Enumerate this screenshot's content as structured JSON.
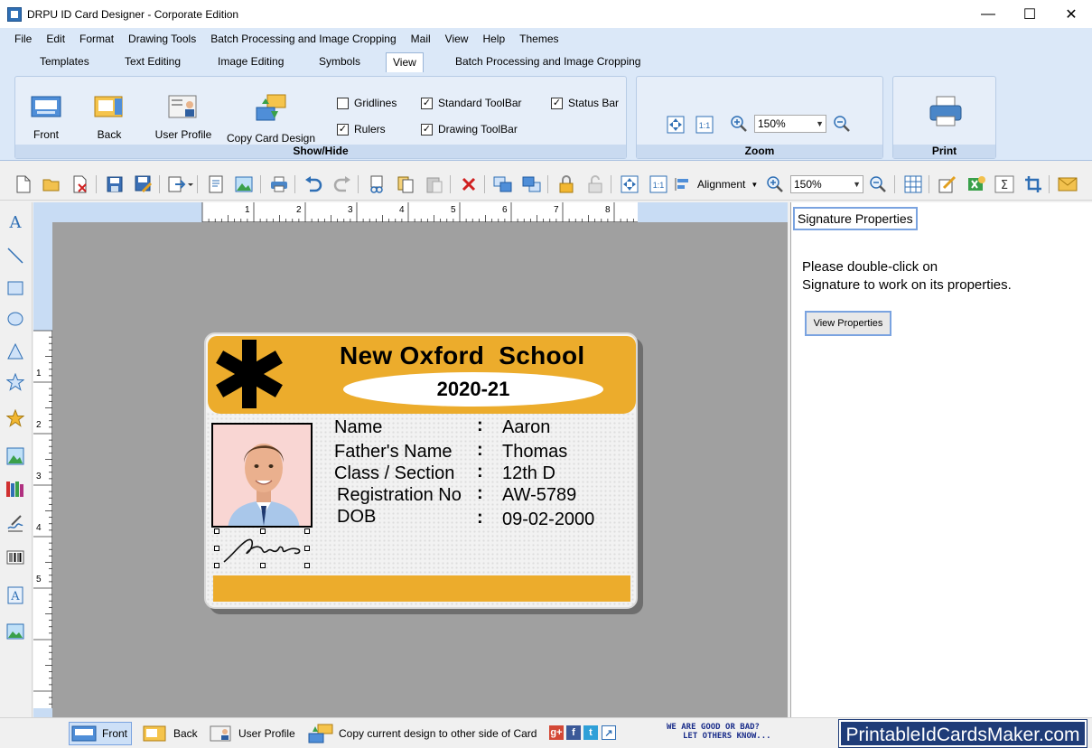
{
  "window": {
    "title": "DRPU ID Card Designer - Corporate Edition",
    "controls": [
      "—",
      "☐",
      "✕"
    ]
  },
  "menu": [
    "File",
    "Edit",
    "Format",
    "Drawing Tools",
    "Batch Processing and Image Cropping",
    "Mail",
    "View",
    "Help",
    "Themes"
  ],
  "ribbon_tabs": [
    "Templates",
    "Text Editing",
    "Image Editing",
    "Symbols",
    "View",
    "Batch Processing and Image Cropping"
  ],
  "ribbon": {
    "show_hide": {
      "label": "Show/Hide",
      "buttons": [
        "Front",
        "Back",
        "User Profile",
        "Copy Card Design"
      ],
      "checks": [
        {
          "label": "Gridlines",
          "checked": false
        },
        {
          "label": "Rulers",
          "checked": true
        },
        {
          "label": "Standard ToolBar",
          "checked": true
        },
        {
          "label": "Drawing ToolBar",
          "checked": true
        },
        {
          "label": "Status Bar",
          "checked": true
        }
      ]
    },
    "zoom": {
      "label": "Zoom",
      "value": "150%"
    },
    "print": {
      "label": "Print"
    }
  },
  "toolbar": {
    "alignment_label": "Alignment",
    "zoom_value": "150%"
  },
  "ruler": {
    "h": [
      "1",
      "2",
      "3",
      "4",
      "5",
      "6",
      "7",
      "8"
    ],
    "v": [
      "1",
      "2",
      "3",
      "4",
      "5"
    ]
  },
  "card": {
    "school": "New Oxford  School",
    "year": "2020-21",
    "fields": [
      {
        "label": "Name",
        "value": "Aaron"
      },
      {
        "label": "Father's Name",
        "value": "Thomas"
      },
      {
        "label": "Class / Section",
        "value": "12th D"
      },
      {
        "label": "Registration No",
        "value": "AW-5789"
      },
      {
        "label": "DOB",
        "value": "09-02-2000"
      }
    ],
    "colon": ":"
  },
  "properties": {
    "title": "Signature Properties",
    "message": "Please double-click on\nSignature to work on its properties.",
    "button": "View Properties"
  },
  "statusbar": {
    "front": "Front",
    "back": "Back",
    "user_profile": "User Profile",
    "copy": "Copy current design to other side of Card",
    "feedback_line1": "WE ARE GOOD OR BAD?",
    "feedback_line2": "LET OTHERS KNOW...",
    "brand": "PrintableIdCardsMaker.com"
  },
  "colors": {
    "accent": "#ecac2c",
    "ribbon": "#dbe8f8",
    "canvas": "#a0a0a0",
    "brand": "#1f3c78"
  }
}
